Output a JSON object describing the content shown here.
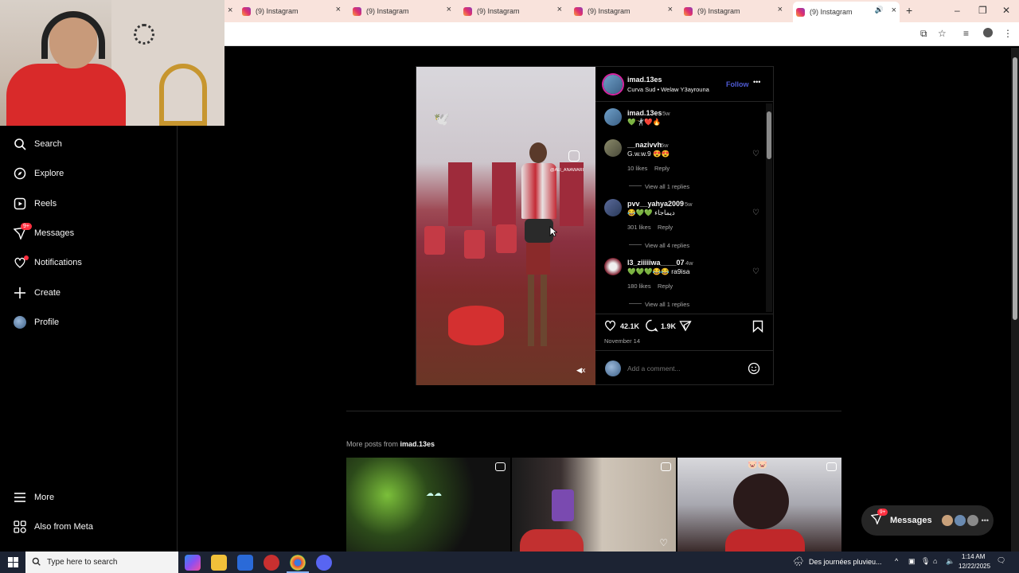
{
  "browser": {
    "tabs": [
      {
        "title": "(9) Instagram"
      },
      {
        "title": "(9) Instagram"
      },
      {
        "title": "(9) Instagram"
      },
      {
        "title": "(9) Instagram"
      },
      {
        "title": "(9) Instagram"
      },
      {
        "title": "(9) Instagram",
        "active": true
      }
    ],
    "new_tab_glyph": "+",
    "close_glyph": "×",
    "window_controls": {
      "minimize": "–",
      "restore": "❐",
      "close": "✕"
    }
  },
  "sidebar": {
    "items": [
      {
        "label": "Search",
        "icon": "search-icon"
      },
      {
        "label": "Explore",
        "icon": "compass-icon"
      },
      {
        "label": "Reels",
        "icon": "reels-icon"
      },
      {
        "label": "Messages",
        "icon": "messenger-icon",
        "badge": "9+"
      },
      {
        "label": "Notifications",
        "icon": "heart-icon"
      },
      {
        "label": "Create",
        "icon": "plus-icon"
      },
      {
        "label": "Profile",
        "icon": "avatar"
      }
    ],
    "bottom": [
      {
        "label": "More",
        "icon": "menu-icon"
      },
      {
        "label": "Also from Meta",
        "icon": "meta-icon"
      }
    ]
  },
  "post": {
    "header": {
      "username": "imad.13es",
      "subtitle": "Curva Sud • Welaw Y3ayrouna",
      "follow": "Follow",
      "more": "•••"
    },
    "video_watermark": "@ALI_ANAWARI",
    "caption": {
      "username": "imad.13es",
      "time": "5w",
      "text": "💚🤺❤️🔥"
    },
    "comments": [
      {
        "username": "__nazivvh",
        "time": "5w",
        "text": "G.w.w.9 😍😍",
        "likes": "10 likes",
        "reply": "Reply",
        "view_replies": "View all 1 replies"
      },
      {
        "username": "pvv__yahya2009",
        "time": "5w",
        "text": "😂💚💚 ديماجاء",
        "likes": "301 likes",
        "reply": "Reply",
        "view_replies": "View all 4 replies"
      },
      {
        "username": "l3_ziiiiiwa____07",
        "time": "4w",
        "text": "💚💚💚😂😂 ra9isa",
        "likes": "180 likes",
        "reply": "Reply",
        "view_replies": "View all 1 replies"
      }
    ],
    "actions": {
      "likes": "42.1K",
      "comments": "1.9K"
    },
    "date": "November 14",
    "add_comment_placeholder": "Add a comment..."
  },
  "more_posts": {
    "label_prefix": "More posts from ",
    "username": "imad.13es"
  },
  "messages_pill": {
    "label": "Messages",
    "badge": "9+"
  },
  "taskbar": {
    "search_placeholder": "Type here to search",
    "weather": "Des journées pluvieu...",
    "time": "1:14 AM",
    "date": "12/22/2025"
  },
  "colors": {
    "accent_blue": "#4f5bd5",
    "follow_blue": "#0095f6",
    "notification_red": "#ff3040",
    "tab_bar": "#f9e3dc"
  }
}
